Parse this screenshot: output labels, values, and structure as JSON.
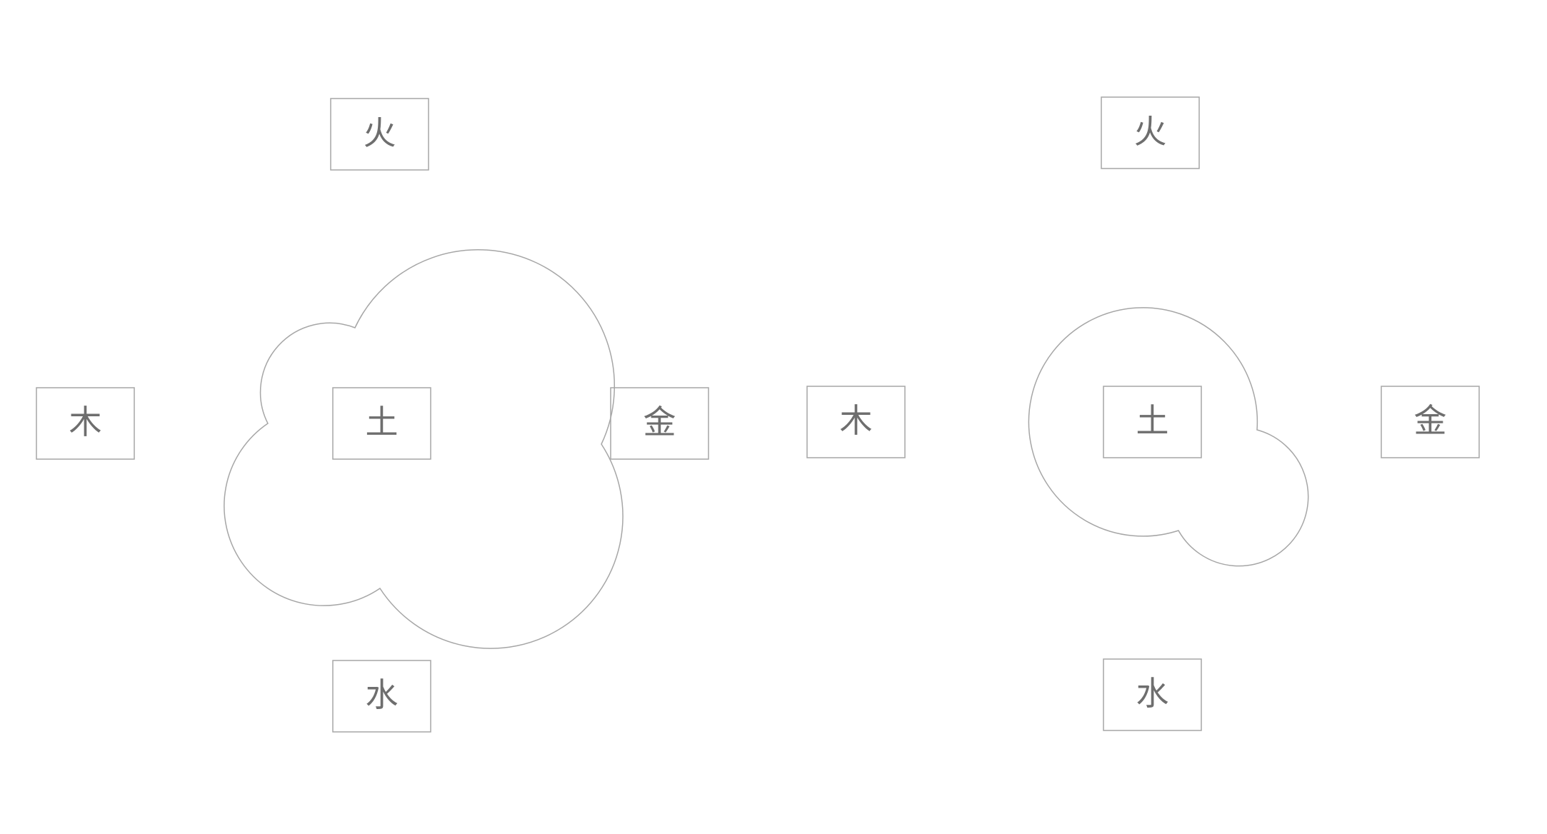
{
  "colors": {
    "background": "#ffffff",
    "stroke": "#a6a6a6",
    "text": "#6e6e6e"
  },
  "diagrams": [
    {
      "nodes": {
        "fire": "火",
        "wood": "木",
        "earth": "土",
        "metal": "金",
        "water": "水"
      }
    },
    {
      "nodes": {
        "fire": "火",
        "wood": "木",
        "earth": "土",
        "metal": "金",
        "water": "水"
      }
    }
  ]
}
